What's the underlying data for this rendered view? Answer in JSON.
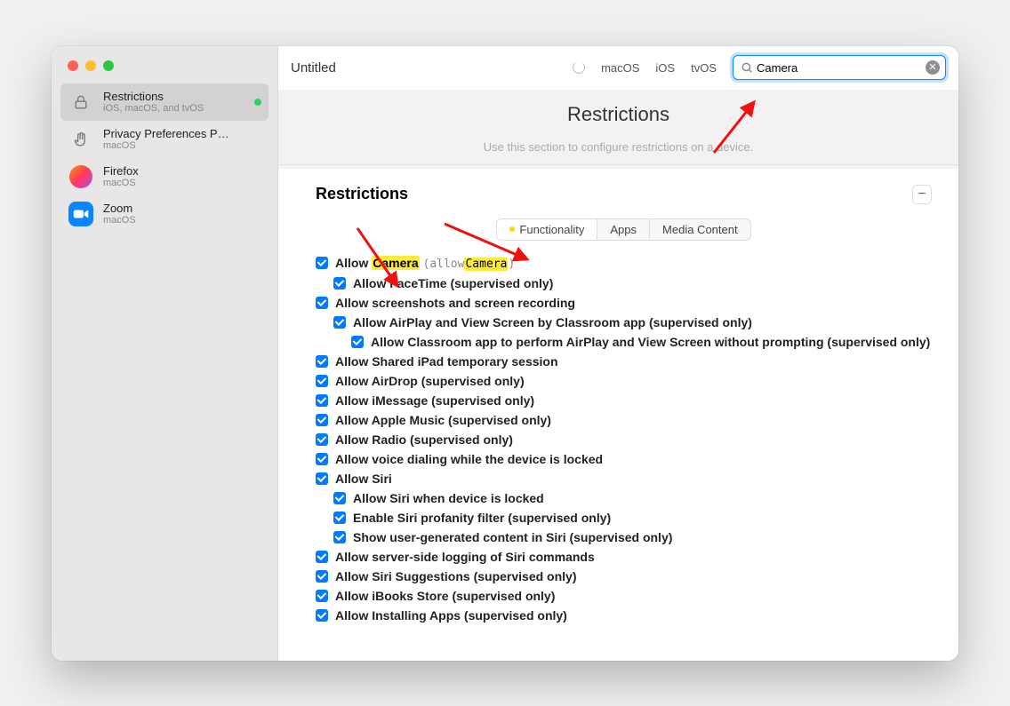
{
  "window_title": "Untitled",
  "sidebar": {
    "items": [
      {
        "title": "Restrictions",
        "sub": "iOS, macOS, and tvOS",
        "icon": "lock-icon",
        "selected": true,
        "dot": true
      },
      {
        "title": "Privacy Preferences P…",
        "sub": "macOS",
        "icon": "hand-icon"
      },
      {
        "title": "Firefox",
        "sub": "macOS",
        "icon": "firefox-icon"
      },
      {
        "title": "Zoom",
        "sub": "macOS",
        "icon": "zoom-icon"
      }
    ]
  },
  "toolbar": {
    "platforms": [
      "macOS",
      "iOS",
      "tvOS"
    ],
    "search_value": "Camera"
  },
  "banner": {
    "heading": "Restrictions",
    "sub": "Use this section to configure restrictions on a device."
  },
  "section": {
    "title": "Restrictions",
    "tabs": [
      "Functionality",
      "Apps",
      "Media Content"
    ],
    "active_tab": 0
  },
  "highlight": "Camera",
  "rows": [
    {
      "level": 1,
      "text": "Allow Camera",
      "hint": "(allowCamera)",
      "highlight_in_text": true,
      "highlight_in_hint": true
    },
    {
      "level": 2,
      "text": "Allow FaceTime (supervised only)"
    },
    {
      "level": 1,
      "text": "Allow screenshots and screen recording"
    },
    {
      "level": 2,
      "text": "Allow AirPlay and View Screen by Classroom app (supervised only)"
    },
    {
      "level": 3,
      "text": "Allow Classroom app to perform AirPlay and View Screen without prompting (supervised only)"
    },
    {
      "level": 1,
      "text": "Allow Shared iPad temporary session"
    },
    {
      "level": 1,
      "text": "Allow AirDrop (supervised only)"
    },
    {
      "level": 1,
      "text": "Allow iMessage (supervised only)"
    },
    {
      "level": 1,
      "text": "Allow Apple Music (supervised only)"
    },
    {
      "level": 1,
      "text": "Allow Radio (supervised only)"
    },
    {
      "level": 1,
      "text": "Allow voice dialing while the device is locked"
    },
    {
      "level": 1,
      "text": "Allow Siri"
    },
    {
      "level": 2,
      "text": "Allow Siri when device is locked"
    },
    {
      "level": 2,
      "text": "Enable Siri profanity filter (supervised only)"
    },
    {
      "level": 2,
      "text": "Show user-generated content in Siri (supervised only)"
    },
    {
      "level": 1,
      "text": "Allow server-side logging of Siri commands"
    },
    {
      "level": 1,
      "text": "Allow Siri Suggestions (supervised only)"
    },
    {
      "level": 1,
      "text": "Allow iBooks Store (supervised only)"
    },
    {
      "level": 1,
      "text": "Allow Installing Apps (supervised only)"
    }
  ]
}
